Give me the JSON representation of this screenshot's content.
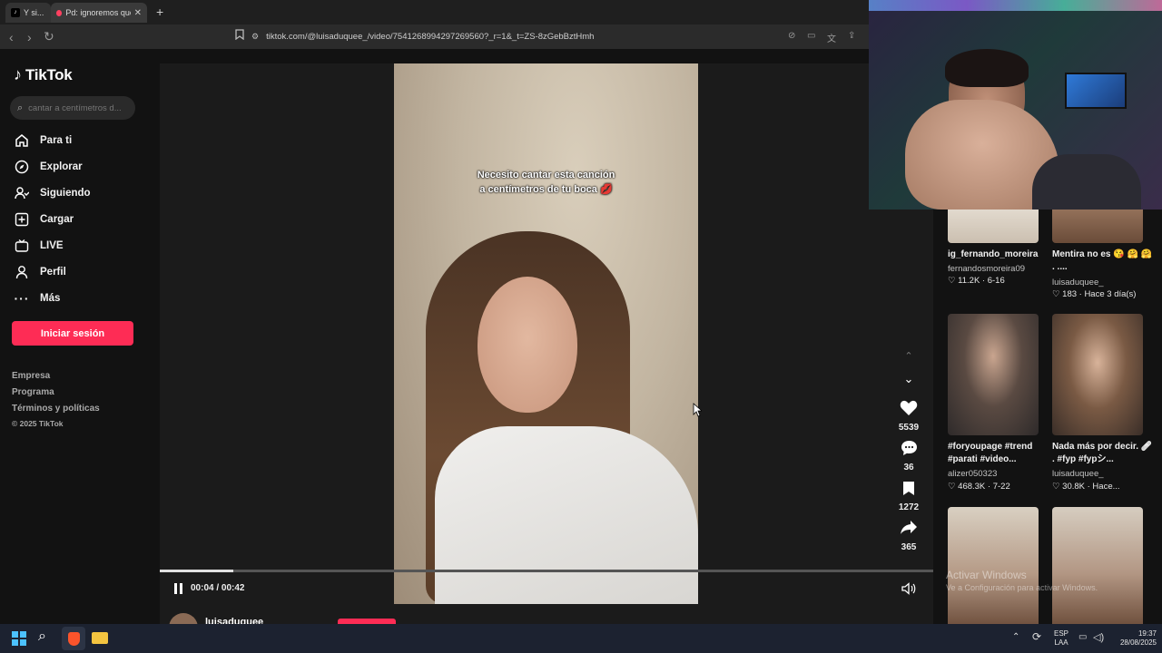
{
  "browser": {
    "tabs": [
      {
        "label": "Y si..."
      },
      {
        "label": "Pd: ignoremos que n..."
      }
    ],
    "url": "tiktok.com/@luisaduquee_/video/7541268994297269560?_r=1&_t=ZS-8zGebBztHmh"
  },
  "sidebar": {
    "logo": "TikTok",
    "search_placeholder": "cantar a centímetros d...",
    "items": [
      {
        "label": "Para ti",
        "icon": "home-icon"
      },
      {
        "label": "Explorar",
        "icon": "compass-icon"
      },
      {
        "label": "Siguiendo",
        "icon": "following-icon"
      },
      {
        "label": "Cargar",
        "icon": "upload-icon"
      },
      {
        "label": "LIVE",
        "icon": "live-icon"
      },
      {
        "label": "Perfil",
        "icon": "profile-icon"
      },
      {
        "label": "Más",
        "icon": "more-icon"
      }
    ],
    "login_label": "Iniciar sesión",
    "footer": [
      "Empresa",
      "Programa",
      "Términos y políticas",
      "© 2025 TikTok"
    ]
  },
  "video": {
    "caption_line1": "Necesito cantar esta canción",
    "caption_line2": "a centímetros de tu boca 💋",
    "time": "00:04 / 00:42",
    "progress": 0.095,
    "author": "luisaduquee_"
  },
  "actions": {
    "likes": "5539",
    "comments": "36",
    "saves": "1272",
    "shares": "365"
  },
  "related": [
    {
      "title": "ig_fernando_moreira",
      "author": "fernandosmoreira09",
      "stats": "♡ 11.2K · 6-16"
    },
    {
      "title": "Mentira no es 😘 🤗 🤗 . ....",
      "author": "luisaduquee_",
      "stats": "♡ 183 · Hace 3 día(s)"
    },
    {
      "title": "#foryoupage #trend #parati #video...",
      "author": "alizer050323",
      "stats": "♡ 468.3K · 7-22"
    },
    {
      "title": "Nada más por decir. 🩹 . #fyp #fypシ...",
      "author": "luisaduquee_",
      "stats": "♡ 30.8K · Hace..."
    }
  ],
  "watermark": {
    "line1": "Activar Windows",
    "line2": "Ve a Configuración para activar Windows."
  },
  "taskbar": {
    "lang1": "ESP",
    "lang2": "LAA",
    "time": "19:37",
    "date": "28/08/2025"
  },
  "colors": {
    "accent": "#fe2c55",
    "background": "#121212",
    "player_bg": "#1b1b1b"
  }
}
